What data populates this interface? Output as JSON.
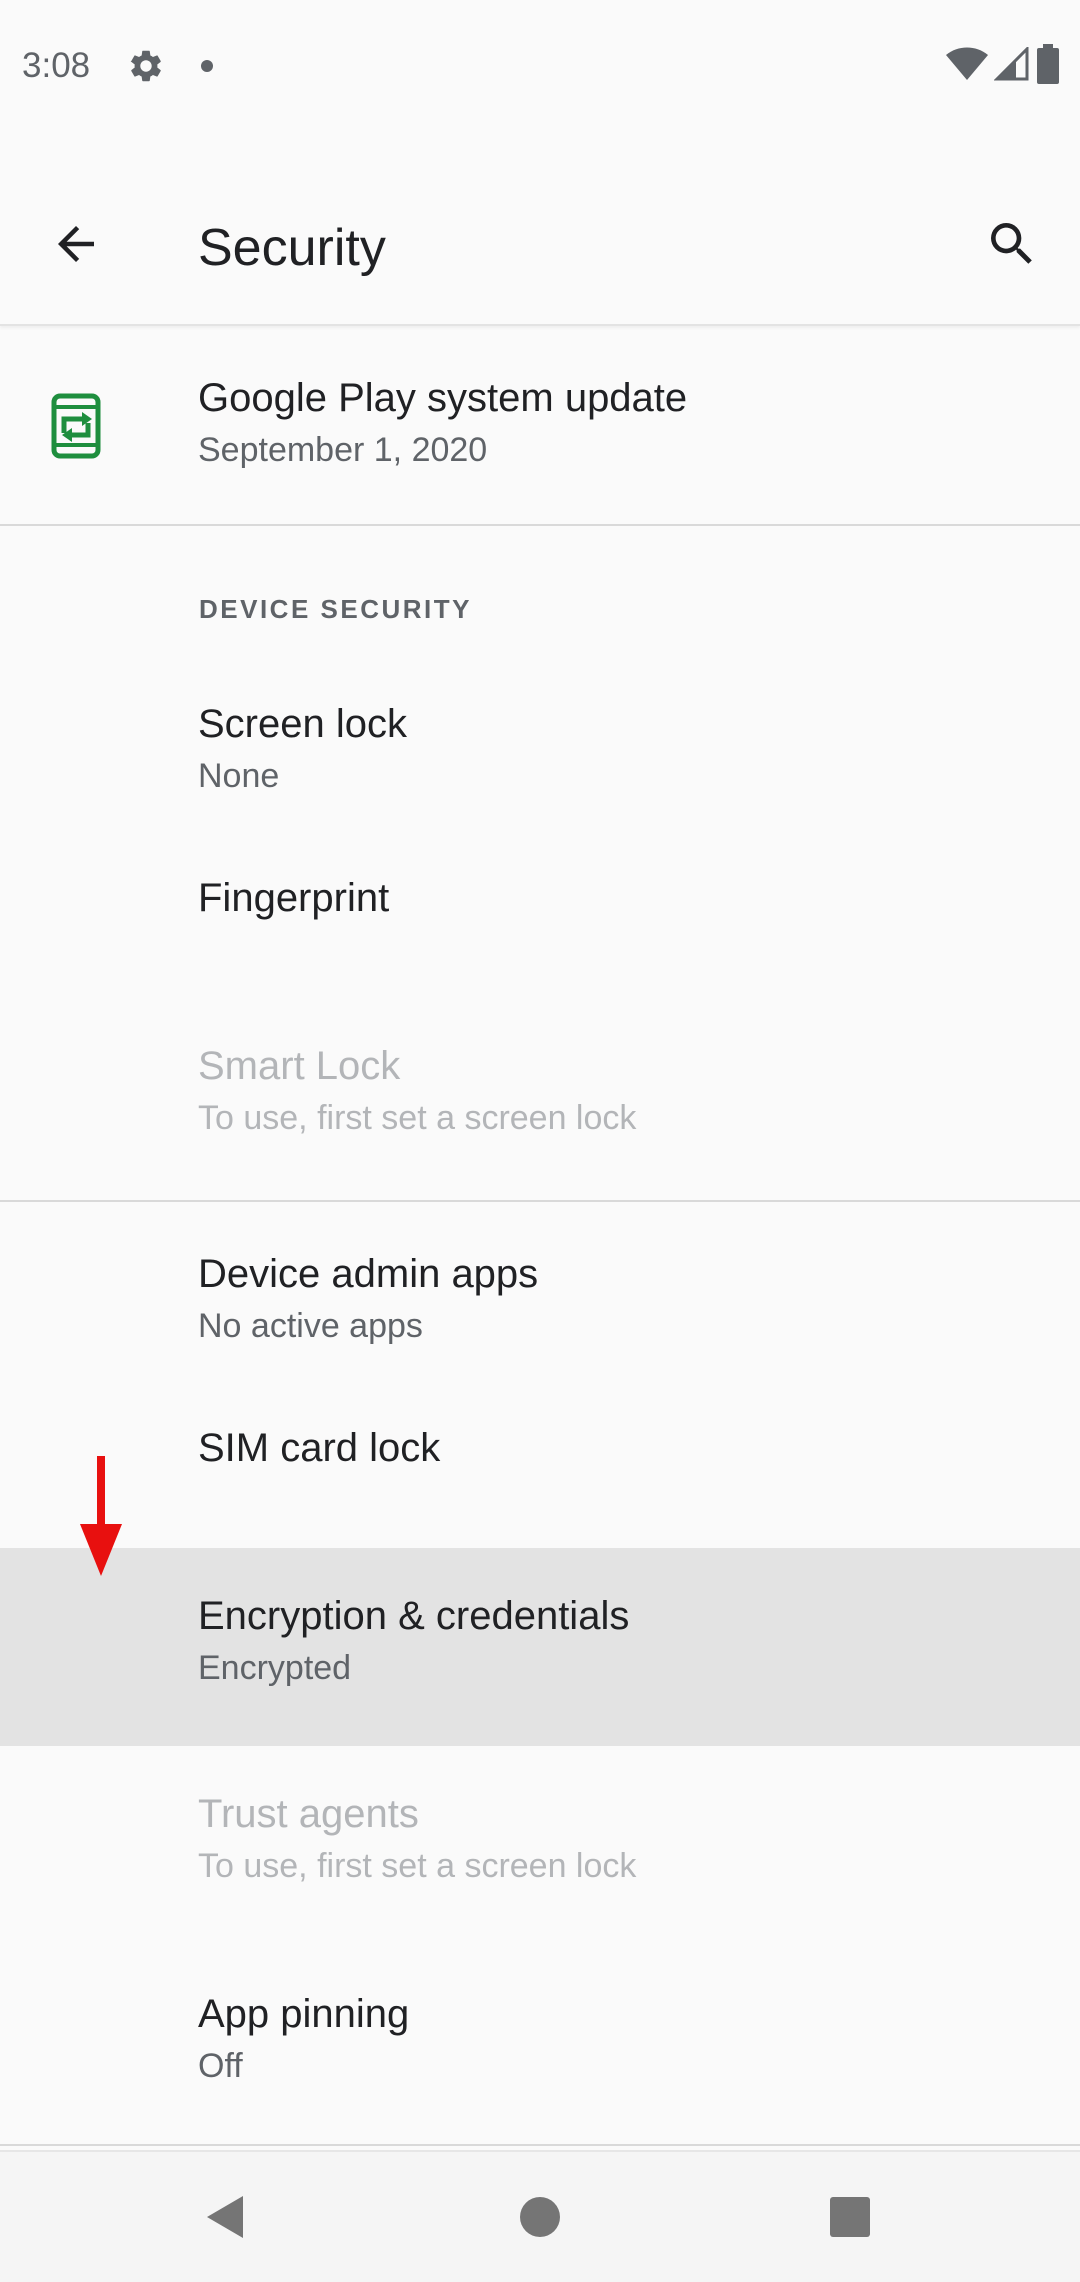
{
  "status_bar": {
    "time": "3:08",
    "icons": [
      "gear-icon",
      "notification-dot-icon",
      "wifi-icon",
      "cellular-signal-icon",
      "battery-icon"
    ]
  },
  "app_bar": {
    "title": "Security",
    "back_icon": "arrow-back-icon",
    "search_icon": "search-icon"
  },
  "list": {
    "system_update": {
      "title": "Google Play system update",
      "subtitle": "September 1, 2020",
      "icon": "system-update-icon",
      "icon_color": "#1e8e3e"
    },
    "section_device_security": "DEVICE SECURITY",
    "screen_lock": {
      "title": "Screen lock",
      "subtitle": "None"
    },
    "fingerprint": {
      "title": "Fingerprint"
    },
    "smart_lock": {
      "title": "Smart Lock",
      "subtitle": "To use, first set a screen lock"
    },
    "device_admin": {
      "title": "Device admin apps",
      "subtitle": "No active apps"
    },
    "sim_lock": {
      "title": "SIM card lock"
    },
    "encryption": {
      "title": "Encryption & credentials",
      "subtitle": "Encrypted"
    },
    "trust_agents": {
      "title": "Trust agents",
      "subtitle": "To use, first set a screen lock"
    },
    "app_pinning": {
      "title": "App pinning",
      "subtitle": "Off"
    }
  },
  "annotation": {
    "arrow_color": "#e8100f",
    "arrow_icon": "red-arrow-down-icon"
  },
  "nav_bar": {
    "icons": [
      "nav-back-icon",
      "nav-home-icon",
      "nav-recents-icon"
    ]
  },
  "colors": {
    "background": "#fafafa",
    "highlight": "#e3e3e3",
    "accent_green": "#1e8e3e"
  }
}
